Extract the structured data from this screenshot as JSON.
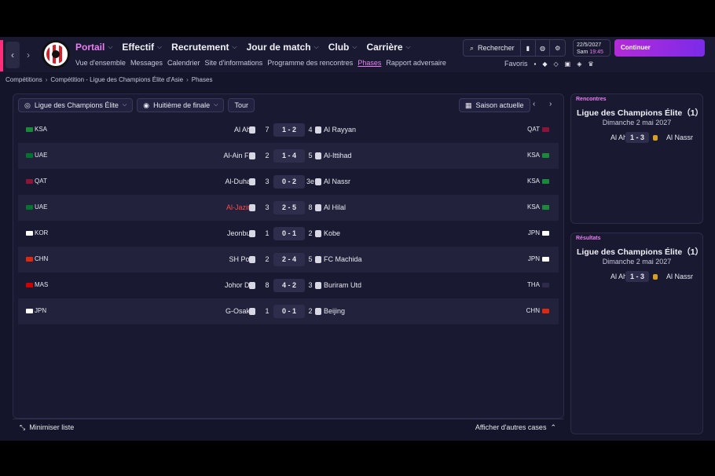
{
  "nav": {
    "main": [
      {
        "label": "Portail",
        "active": true
      },
      {
        "label": "Effectif",
        "active": false
      },
      {
        "label": "Recrutement",
        "active": false
      },
      {
        "label": "Jour de match",
        "active": false
      },
      {
        "label": "Club",
        "active": false
      },
      {
        "label": "Carrière",
        "active": false
      }
    ],
    "sub": [
      {
        "label": "Vue d'ensemble",
        "active": false
      },
      {
        "label": "Messages",
        "active": false
      },
      {
        "label": "Calendrier",
        "active": false
      },
      {
        "label": "Site d'informations",
        "active": false
      },
      {
        "label": "Programme des rencontres",
        "active": false
      },
      {
        "label": "Phases",
        "active": true
      },
      {
        "label": "Rapport adversaire",
        "active": false
      }
    ],
    "search_label": "Rechercher",
    "date": "22/5/2027",
    "day": "Sam",
    "time": "19:45",
    "continue_label": "Continuer",
    "favorites_label": "Favoris"
  },
  "breadcrumb": [
    "Compétitions",
    "Compétition - Ligue des Champions Élite d'Asie",
    "Phases"
  ],
  "toolbar": {
    "competition": "Ligue des Champions Élite",
    "round": "Huitième de finale",
    "tour": "Tour",
    "season": "Saison actuelle"
  },
  "fixtures": [
    {
      "home_country": "KSA",
      "home_flag": "#1a8a3a",
      "home": "Al Ahli",
      "home_agg": "7",
      "score": "1 - 2",
      "away_agg": "4",
      "away": "Al Rayyan",
      "away_country": "QAT",
      "away_flag": "#8a1538",
      "home_red": false
    },
    {
      "home_country": "UAE",
      "home_flag": "#00732f",
      "home": "Al-Ain FC",
      "home_agg": "2",
      "score": "1 - 4",
      "away_agg": "5",
      "away": "Al-Ittihad",
      "away_country": "KSA",
      "away_flag": "#1a8a3a",
      "home_red": false
    },
    {
      "home_country": "QAT",
      "home_flag": "#8a1538",
      "home": "Al-Duhail",
      "home_agg": "3",
      "score": "0 - 2",
      "away_agg": "3e",
      "away": "Al Nassr",
      "away_country": "KSA",
      "away_flag": "#1a8a3a",
      "home_red": false
    },
    {
      "home_country": "UAE",
      "home_flag": "#00732f",
      "home": "Al-Jazira",
      "home_agg": "3",
      "score": "2 - 5",
      "away_agg": "8",
      "away": "Al Hilal",
      "away_country": "KSA",
      "away_flag": "#1a8a3a",
      "home_red": true
    },
    {
      "home_country": "KOR",
      "home_flag": "#ffffff",
      "home": "Jeonbuk",
      "home_agg": "1",
      "score": "0 - 1",
      "away_agg": "2",
      "away": "Kobe",
      "away_country": "JPN",
      "away_flag": "#ffffff",
      "home_red": false
    },
    {
      "home_country": "CHN",
      "home_flag": "#de2910",
      "home": "SH Port",
      "home_agg": "2",
      "score": "2 - 4",
      "away_agg": "5",
      "away": "FC Machida",
      "away_country": "JPN",
      "away_flag": "#ffffff",
      "home_red": false
    },
    {
      "home_country": "MAS",
      "home_flag": "#cc0001",
      "home": "Johor DT",
      "home_agg": "8",
      "score": "4 - 2",
      "away_agg": "3",
      "away": "Buriram Utd",
      "away_country": "THA",
      "away_flag": "#2d2a4a",
      "home_red": false
    },
    {
      "home_country": "JPN",
      "home_flag": "#ffffff",
      "home": "G-Osaka",
      "home_agg": "1",
      "score": "0 - 1",
      "away_agg": "2",
      "away": "Beijing",
      "away_country": "CHN",
      "away_flag": "#de2910",
      "home_red": false
    }
  ],
  "bottom": {
    "minimize": "Minimiser liste",
    "show_more": "Afficher d'autres cases"
  },
  "side_next": {
    "title": "Rencontres",
    "competition": "Ligue des Champions Élite（1）",
    "date": "Dimanche 2 mai 2027",
    "home": "Al Ahli",
    "score": "1 - 3",
    "away": "Al Nassr"
  },
  "side_results": {
    "title": "Résultats",
    "competition": "Ligue des Champions Élite（1）",
    "date": "Dimanche 2 mai 2027",
    "home": "Al Ahli",
    "score": "1 - 3",
    "away": "Al Nassr"
  }
}
